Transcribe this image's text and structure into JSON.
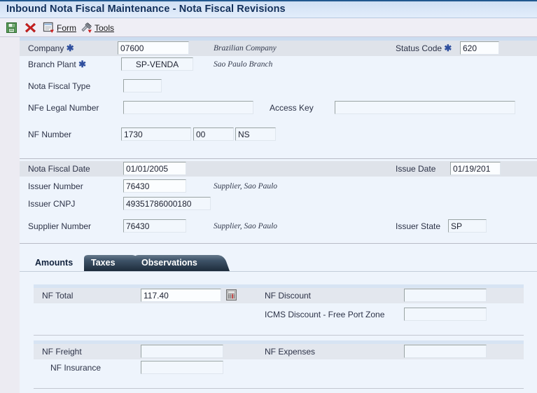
{
  "window": {
    "title": "Inbound Nota Fiscal Maintenance - Nota Fiscal Revisions"
  },
  "toolbar": {
    "items": [
      {
        "name": "save-icon",
        "label": "",
        "icon": "floppy-disk-icon"
      },
      {
        "name": "delete-icon",
        "label": "",
        "icon": "red-x-icon"
      },
      {
        "name": "form-menu",
        "label": "Form",
        "icon": "form-window-icon"
      },
      {
        "name": "tools-menu",
        "label": "Tools",
        "icon": "tools-hammer-icon"
      }
    ],
    "form_label": "Form",
    "tools_label": "Tools"
  },
  "header_section": {
    "company": {
      "label": "Company",
      "required": true,
      "value": "07600",
      "description": "Brazilian Company"
    },
    "status_code": {
      "label": "Status Code",
      "required": true,
      "value": "620"
    },
    "branch_plant": {
      "label": "Branch Plant",
      "required": true,
      "value": "SP-VENDA",
      "description": "Sao Paulo Branch"
    },
    "nota_fiscal_type": {
      "label": "Nota Fiscal Type",
      "value": ""
    },
    "nfe_legal_number": {
      "label": "NFe Legal Number",
      "value": ""
    },
    "access_key": {
      "label": "Access Key",
      "value": ""
    },
    "nf_number": {
      "label": "NF Number",
      "value": "1730",
      "value2": "00",
      "value3": "NS"
    }
  },
  "issuer_section": {
    "nota_fiscal_date": {
      "label": "Nota Fiscal Date",
      "value": "01/01/2005"
    },
    "issue_date": {
      "label": "Issue Date",
      "value": "01/19/201"
    },
    "issuer_number": {
      "label": "Issuer Number",
      "value": "76430",
      "description": "Supplier, Sao Paulo"
    },
    "issuer_cnpj": {
      "label": "Issuer CNPJ",
      "value": "49351786000180"
    },
    "supplier_number": {
      "label": "Supplier Number",
      "value": "76430",
      "description": "Supplier, Sao Paulo"
    },
    "issuer_state": {
      "label": "Issuer State",
      "value": "SP"
    }
  },
  "tabs": [
    {
      "label": "Amounts",
      "active": true
    },
    {
      "label": "Taxes",
      "active": false
    },
    {
      "label": "Observations",
      "active": false
    }
  ],
  "amounts_panel": {
    "nf_total": {
      "label": "NF Total",
      "value": "117.40",
      "icon": "calculator-icon"
    },
    "nf_discount": {
      "label": "NF Discount",
      "value": ""
    },
    "icms_discount": {
      "label": "ICMS Discount - Free Port Zone",
      "value": ""
    },
    "nf_freight": {
      "label": "NF Freight",
      "value": ""
    },
    "nf_expenses": {
      "label": "NF Expenses",
      "value": ""
    },
    "nf_insurance": {
      "label": "NF Insurance",
      "value": ""
    }
  },
  "colors": {
    "title_bar": "#d6e4f5",
    "title_text": "#12305b",
    "form_bg": "#eef4fc",
    "band": "#dfe3ea",
    "strip": "#ccdcf0",
    "required_star": "#2f4f9e",
    "tab_active_text": "#11223d",
    "tab_inactive_bg": "#2c3e52"
  }
}
